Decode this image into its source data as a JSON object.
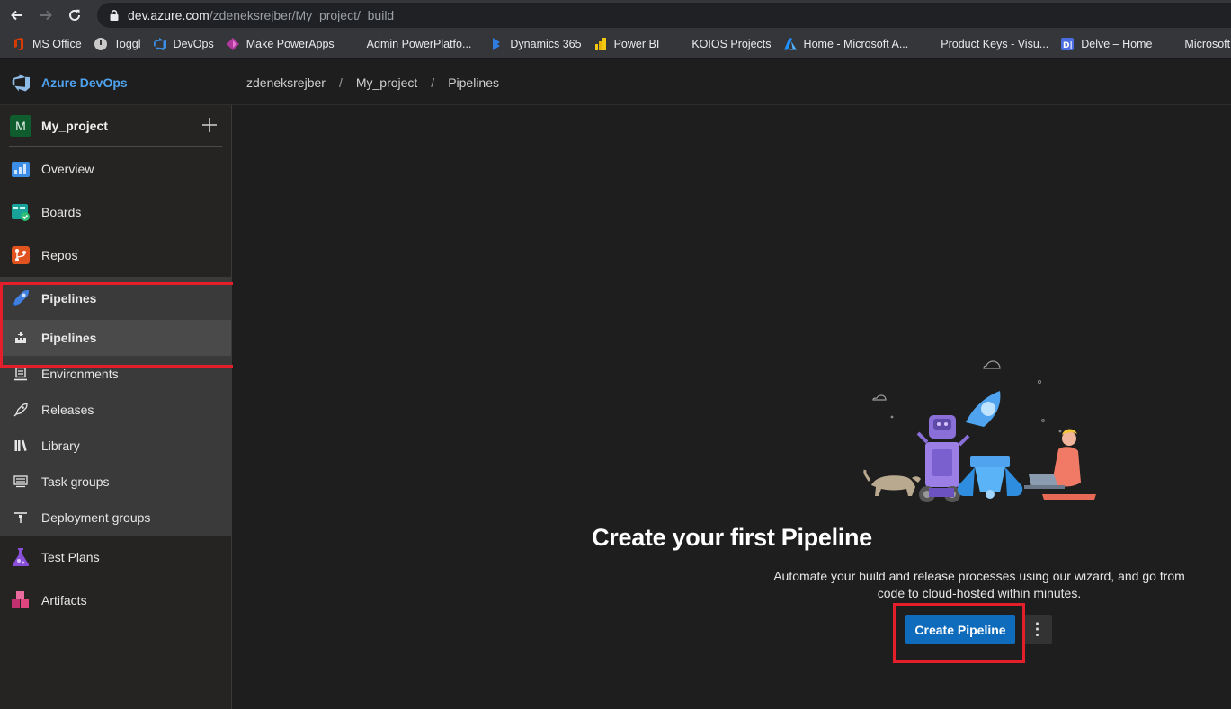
{
  "browser": {
    "url_host": "dev.azure.com",
    "url_path": "/zdeneksrejber/My_project/_build",
    "bookmarks": [
      {
        "label": "MS Office",
        "icon": "office-icon"
      },
      {
        "label": "Toggl",
        "icon": "toggl-icon"
      },
      {
        "label": "DevOps",
        "icon": "devops-icon"
      },
      {
        "label": "Make PowerApps",
        "icon": "powerapps-icon"
      },
      {
        "label": "Admin PowerPlatfo...",
        "icon": "microsoft-icon"
      },
      {
        "label": "Dynamics 365",
        "icon": "dynamics-icon"
      },
      {
        "label": "Power BI",
        "icon": "powerbi-icon"
      },
      {
        "label": "KOIOS Projects",
        "icon": "microsoft-icon"
      },
      {
        "label": "Home - Microsoft A...",
        "icon": "azure-icon"
      },
      {
        "label": "Product Keys - Visu...",
        "icon": "microsoft-icon"
      },
      {
        "label": "Delve – Home",
        "icon": "delve-icon"
      },
      {
        "label": "Microsoft le",
        "icon": "microsoft-icon"
      }
    ]
  },
  "header": {
    "brand": "Azure DevOps",
    "breadcrumb": [
      "zdeneksrejber",
      "My_project",
      "Pipelines"
    ],
    "separator": "/"
  },
  "sidebar": {
    "project_initial": "M",
    "project_name": "My_project",
    "items": [
      {
        "label": "Overview"
      },
      {
        "label": "Boards"
      },
      {
        "label": "Repos"
      },
      {
        "label": "Pipelines"
      },
      {
        "label": "Pipelines"
      },
      {
        "label": "Environments"
      },
      {
        "label": "Releases"
      },
      {
        "label": "Library"
      },
      {
        "label": "Task groups"
      },
      {
        "label": "Deployment groups"
      },
      {
        "label": "Test Plans"
      },
      {
        "label": "Artifacts"
      }
    ]
  },
  "main": {
    "title": "Create your first Pipeline",
    "description": "Automate your build and release processes using our wizard, and go from code to cloud-hosted within minutes.",
    "create_button": "Create Pipeline",
    "more_button": "⋮"
  },
  "colors": {
    "accent": "#0f6cbd",
    "brand": "#4fa3ef",
    "highlight": "#e41e2b"
  }
}
